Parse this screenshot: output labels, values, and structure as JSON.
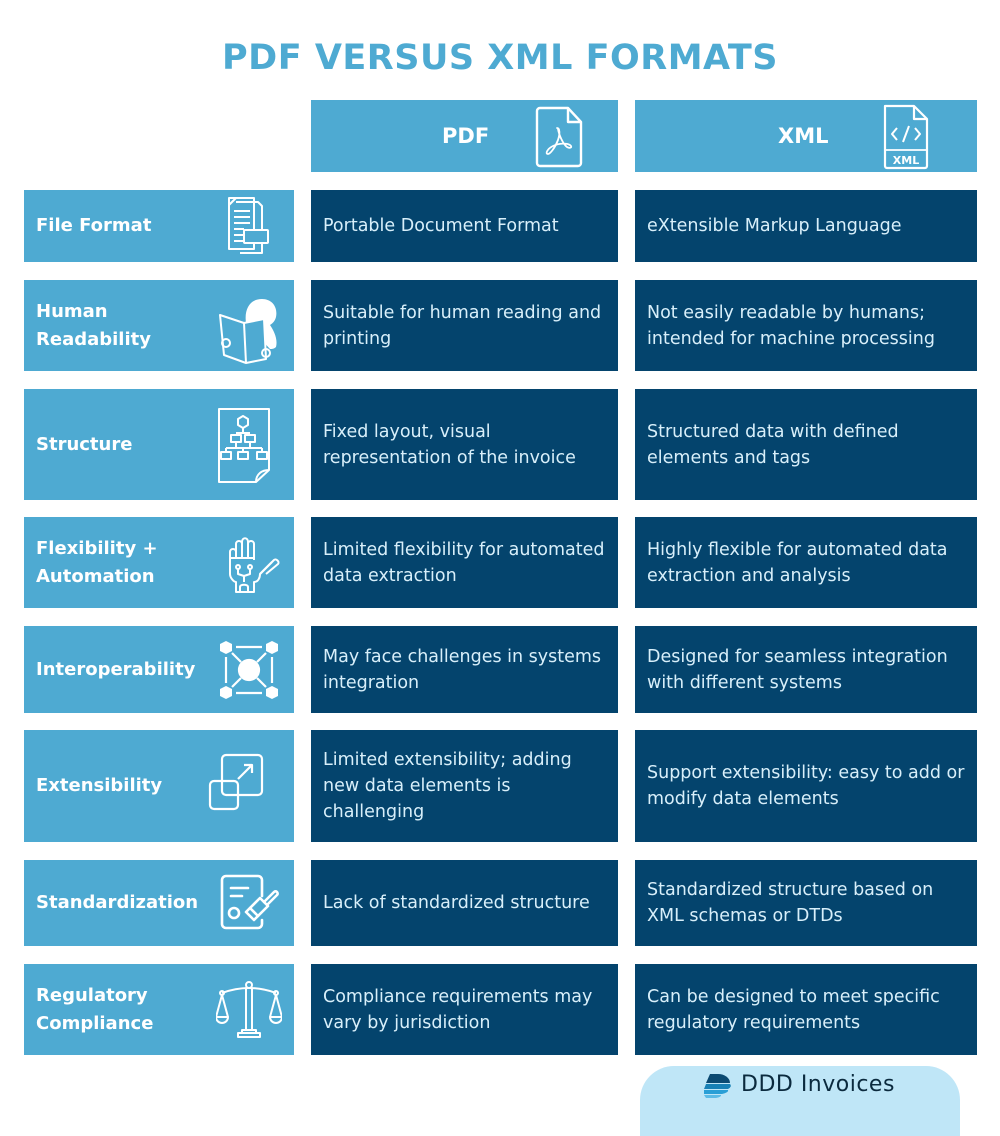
{
  "title": "PDF VERSUS XML FORMATS",
  "colors": {
    "accent": "#4eaad2",
    "cell_dark": "#04446d",
    "cell_text": "#d8effa",
    "brand_bg": "#bfe6f7"
  },
  "columns": [
    {
      "label": "PDF",
      "icon": "pdf-file-icon"
    },
    {
      "label": "XML",
      "icon": "xml-file-icon",
      "icon_text": "XML",
      "icon_code": "</>"
    }
  ],
  "rows": [
    {
      "label": "File Format",
      "icon": "documents-icon",
      "pdf": "Portable Document Format",
      "xml": "eXtensible Markup Language"
    },
    {
      "label": "Human Readability",
      "icon": "person-reading-icon",
      "pdf": "Suitable for human reading and printing",
      "xml": "Not easily readable by humans; intended for machine processing"
    },
    {
      "label": "Structure",
      "icon": "hierarchy-document-icon",
      "pdf": "Fixed layout, visual representation of the invoice",
      "xml": "Structured data with defined elements and tags"
    },
    {
      "label": "Flexibility + Automation",
      "icon": "robot-hand-icon",
      "pdf": "Limited flexibility for automated data extraction",
      "xml": "Highly flexible for automated data extraction and analysis"
    },
    {
      "label": "Interoperability",
      "icon": "network-nodes-icon",
      "pdf": "May face challenges in systems integration",
      "xml": "Designed for seamless integration with different systems"
    },
    {
      "label": "Extensibility",
      "icon": "expand-squares-icon",
      "pdf": "Limited extensibility; adding new data elements is challenging",
      "xml": "Support extensibility: easy to add or modify data elements"
    },
    {
      "label": "Standardization",
      "icon": "stamp-document-icon",
      "pdf": "Lack of standardized structure",
      "xml": "Standardized structure based on XML schemas or DTDs"
    },
    {
      "label": "Regulatory Compliance",
      "icon": "scales-icon",
      "pdf": "Compliance requirements may vary by jurisdiction",
      "xml": "Can be designed to meet specific regulatory requirements"
    }
  ],
  "brand": {
    "name": "DDD Invoices",
    "icon": "ddd-logo-icon"
  }
}
